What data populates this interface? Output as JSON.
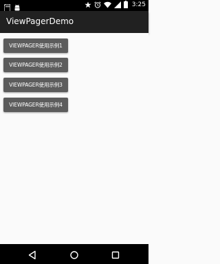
{
  "status_bar": {
    "time": "3:25",
    "left_icons": [
      "sd-card-icon",
      "android-icon"
    ],
    "right_icons": [
      "star-icon",
      "alarm-icon",
      "wifi-icon",
      "signal-icon",
      "battery-icon"
    ]
  },
  "app_bar": {
    "title": "ViewPagerDemo"
  },
  "buttons": [
    {
      "label": "VIEWPAGER使用示例1"
    },
    {
      "label": "VIEWPAGER使用示例2"
    },
    {
      "label": "VIEWPAGER使用示例3"
    },
    {
      "label": "VIEWPAGER使用示例4"
    }
  ],
  "nav_bar": {
    "icons": [
      "back-icon",
      "home-icon",
      "recents-icon"
    ]
  },
  "colors": {
    "status_bar": "#000000",
    "app_bar": "#212121",
    "button": "#5c5c5c",
    "background": "#fafafa"
  }
}
